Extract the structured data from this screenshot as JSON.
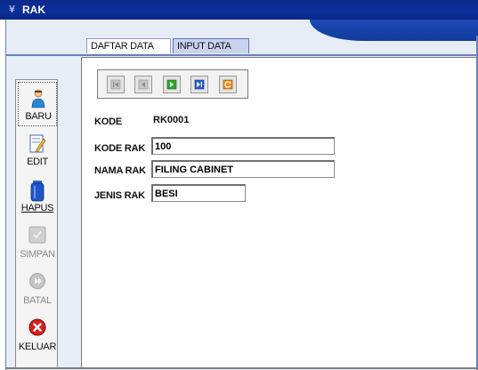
{
  "window": {
    "title": "RAK",
    "title_icon": "app-icon"
  },
  "tabs": [
    {
      "label": "DAFTAR DATA RAK",
      "active": false
    },
    {
      "label": "INPUT DATA RAK",
      "active": true
    }
  ],
  "toolbar": {
    "buttons": [
      {
        "label": "BARU",
        "icon": "user-add-icon",
        "enabled": true
      },
      {
        "label": "EDIT",
        "icon": "edit-icon",
        "enabled": true
      },
      {
        "label": "HAPUS",
        "icon": "trash-icon",
        "enabled": true
      },
      {
        "label": "SIMPAN",
        "icon": "save-check-icon",
        "enabled": false
      },
      {
        "label": "BATAL",
        "icon": "cancel-icon",
        "enabled": false
      },
      {
        "label": "KELUAR",
        "icon": "exit-icon",
        "enabled": true
      }
    ]
  },
  "navigation": {
    "buttons": [
      "first-record-icon",
      "previous-record-icon",
      "next-record-icon",
      "last-record-icon",
      "refresh-icon"
    ]
  },
  "form": {
    "kode_label": "KODE",
    "kode_value": "RK0001",
    "kode_rak_label": "KODE RAK",
    "kode_rak_value": "100",
    "nama_rak_label": "NAMA RAK",
    "nama_rak_value": "FILING CABINET",
    "jenis_rak_label": "JENIS RAK",
    "jenis_rak_value": "BESI"
  },
  "colors": {
    "titlebar": "#0c2f9c",
    "tab_active": "#c8d3ee",
    "nav_green": "#2fa82f",
    "nav_blue": "#2a5fd0",
    "refresh_orange": "#f08a1c",
    "exit_red": "#d81e1e"
  }
}
